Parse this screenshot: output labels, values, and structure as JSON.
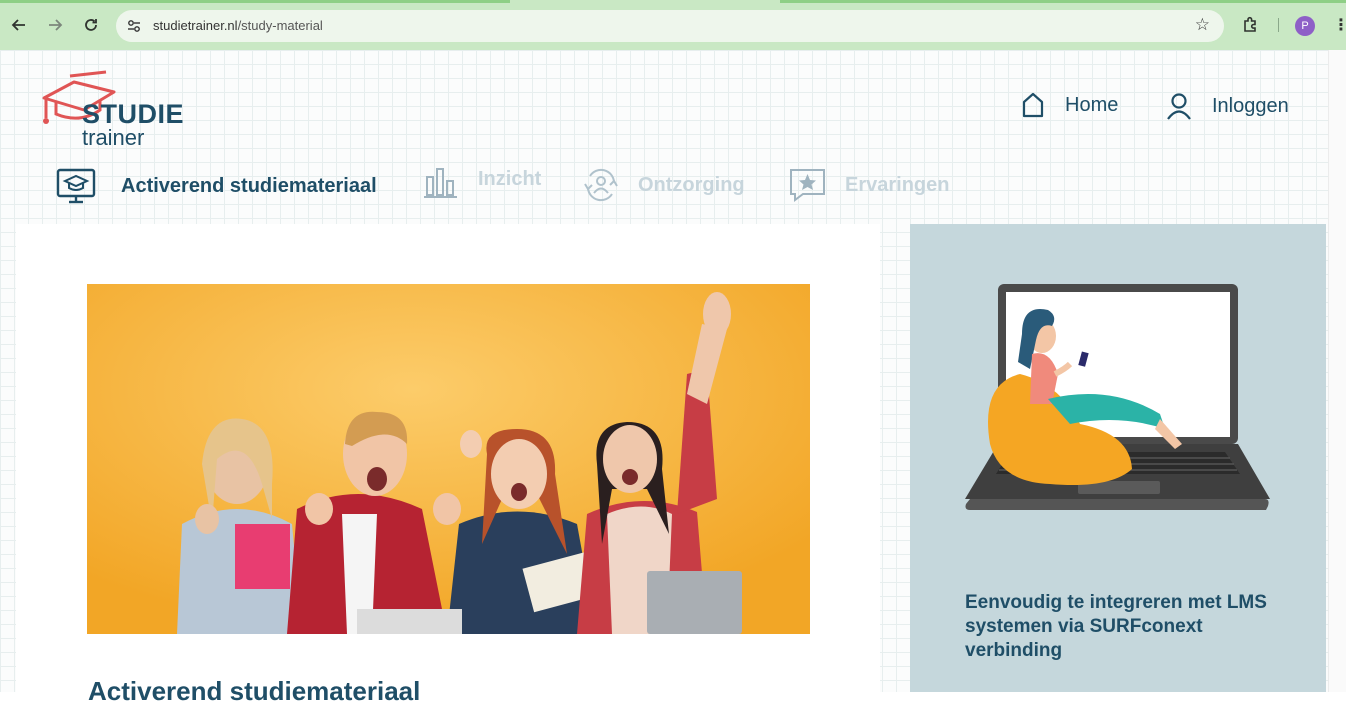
{
  "browser": {
    "url_domain": "studietrainer.nl",
    "url_path": "/study-material",
    "profile_initial": "P"
  },
  "header": {
    "logo_top": "STUDIE",
    "logo_bottom": "trainer",
    "home_label": "Home",
    "login_label": "Inloggen"
  },
  "tabs": [
    {
      "label": "Activerend studiemateriaal",
      "icon": "presentation-icon",
      "active": true
    },
    {
      "label": "Inzicht",
      "icon": "bar-chart-icon",
      "active": false
    },
    {
      "label": "Ontzorging",
      "icon": "user-refresh-icon",
      "active": false
    },
    {
      "label": "Ervaringen",
      "icon": "star-chat-icon",
      "active": false
    }
  ],
  "main": {
    "heading_partial": "Activerend studiemateriaal"
  },
  "side": {
    "text": "Eenvoudig te integreren met LMS systemen via SURFconext verbinding"
  },
  "colors": {
    "brand_dark": "#1f4e67",
    "brand_red": "#e05555",
    "tab_inactive": "#c7d5dc",
    "side_card": "#c5d7dc",
    "hero_bg": "#f6b533"
  }
}
